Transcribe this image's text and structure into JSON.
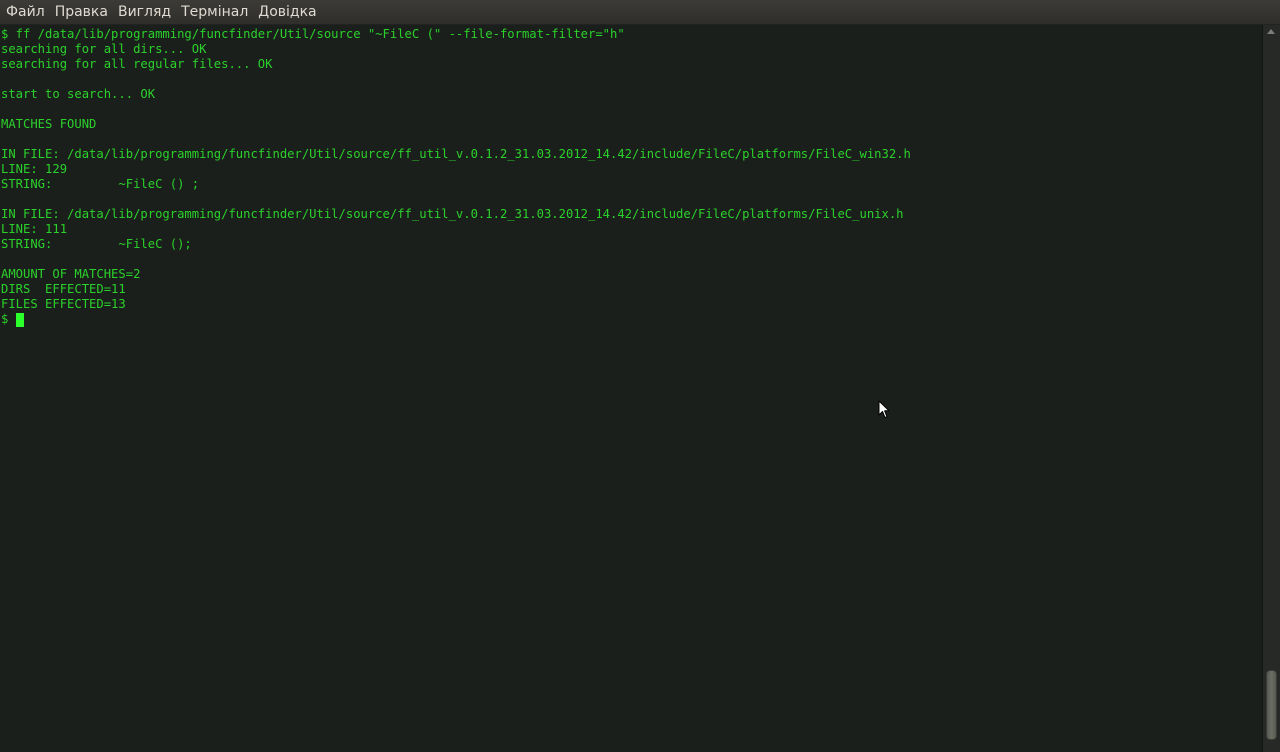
{
  "menubar": {
    "items": [
      "Файл",
      "Правка",
      "Вигляд",
      "Термінал",
      "Довідка"
    ]
  },
  "terminal": {
    "lines": [
      "$ ff /data/lib/programming/funcfinder/Util/source \"~FileC (\" --file-format-filter=\"h\"",
      "searching for all dirs... OK",
      "searching for all regular files... OK",
      "",
      "start to search... OK",
      "",
      "MATCHES FOUND",
      "",
      "IN FILE: /data/lib/programming/funcfinder/Util/source/ff_util_v.0.1.2_31.03.2012_14.42/include/FileC/platforms/FileC_win32.h",
      "LINE: 129",
      "STRING:         ~FileC () ;",
      "",
      "IN FILE: /data/lib/programming/funcfinder/Util/source/ff_util_v.0.1.2_31.03.2012_14.42/include/FileC/platforms/FileC_unix.h",
      "LINE: 111",
      "STRING:         ~FileC ();",
      "",
      "AMOUNT OF MATCHES=2",
      "DIRS  EFFECTED=11",
      "FILES EFFECTED=13"
    ],
    "prompt": "$ "
  },
  "colors": {
    "terminal_bg": "#1b1f1b",
    "terminal_fg": "#2bd12b",
    "menubar_bg": "#3c3b37",
    "menubar_fg": "#dfdbd2"
  },
  "icons": {
    "pointer": "mouse-pointer-icon",
    "scroll_up": "arrow-up-icon"
  }
}
